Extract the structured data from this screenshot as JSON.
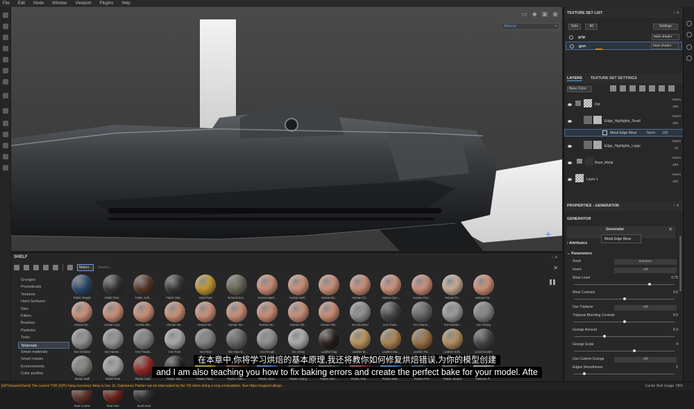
{
  "menu": [
    "File",
    "Edit",
    "Mode",
    "Window",
    "Viewport",
    "Plugins",
    "Help"
  ],
  "viewport": {
    "display_select": "Material"
  },
  "shelf": {
    "title": "SHELF",
    "filter_label": "Materi...",
    "search_placeholder": "Search...",
    "categories": [
      "Grunges",
      "Procedurals",
      "Textures",
      "Hard Surfaces",
      "Skin",
      "Filters",
      "Brushes",
      "Particles",
      "Tools",
      "Materials",
      "Smart materials",
      "Smart masks",
      "Environments",
      "Color profiles"
    ],
    "selected_category": "Materials",
    "materials": [
      {
        "name": "Fabric Rough",
        "color": "#2f4f73"
      },
      {
        "name": "Fabric Rou...",
        "color": "#3a3a3a"
      },
      {
        "name": "Fabric Soft ...",
        "color": "#5b3a2e"
      },
      {
        "name": "Fabric Suit ...",
        "color": "#3b3b3b"
      },
      {
        "name": "Gold Pure",
        "color": "#c9a133"
      },
      {
        "name": "Ground Gra...",
        "color": "#6e6a5c"
      },
      {
        "name": "Human Back...",
        "color": "#d7967e"
      },
      {
        "name": "Human Bell...",
        "color": "#d99a82"
      },
      {
        "name": "Human Bu...",
        "color": "#d99a80"
      },
      {
        "name": "Human Ch...",
        "color": "#d9987f"
      },
      {
        "name": "Human Eye...",
        "color": "#dc9c84"
      },
      {
        "name": "Human Fac...",
        "color": "#d99880"
      },
      {
        "name": "Human Fe...",
        "color": "#d6b8a0"
      },
      {
        "name": "Human For...",
        "color": "#db9880"
      },
      {
        "name": "Human He...",
        "color": "#da9a82"
      },
      {
        "name": "Human Leg...",
        "color": "#d8987f"
      },
      {
        "name": "Human Mo...",
        "color": "#d8987f"
      },
      {
        "name": "Human Ne...",
        "color": "#d9987f"
      },
      {
        "name": "Human Ne...",
        "color": "#da9980"
      },
      {
        "name": "Human No...",
        "color": "#d9987f"
      },
      {
        "name": "Human No...",
        "color": "#d8967e"
      },
      {
        "name": "Human Shi...",
        "color": "#d9997f"
      },
      {
        "name": "Human Wri...",
        "color": "#d7977e"
      },
      {
        "name": "Iron Brushed",
        "color": "#9a9a9a"
      },
      {
        "name": "Iron Chain...",
        "color": "#4a4a4a"
      },
      {
        "name": "Iron Diamo...",
        "color": "#6b6b6b"
      },
      {
        "name": "Iron Galvan...",
        "color": "#a5a5a5"
      },
      {
        "name": "Iron Grainy",
        "color": "#8e8e8e"
      },
      {
        "name": "Iron Grinded",
        "color": "#9c9c9c"
      },
      {
        "name": "Iron Hamm...",
        "color": "#a0a0a0"
      },
      {
        "name": "Iron Powde...",
        "color": "#8a8a8a"
      },
      {
        "name": "Iron Pure",
        "color": "#b4b4b4"
      },
      {
        "name": "Iron Raw",
        "color": "#8c8c8c"
      },
      {
        "name": "Iron Raw D...",
        "color": "#6a6a6a"
      },
      {
        "name": "Iron Rough",
        "color": "#9a9a9a"
      },
      {
        "name": "Iron Shiny",
        "color": "#b8b8b8"
      },
      {
        "name": "Leather bag",
        "color": "#2c2420"
      },
      {
        "name": "Leather Bi...",
        "color": "#caa063"
      },
      {
        "name": "Leather Ma...",
        "color": "#b98c56"
      },
      {
        "name": "Leather Ro...",
        "color": "#a57848"
      },
      {
        "name": "Leather Soft...",
        "color": "#bf9a66"
      },
      {
        "name": "Lizard Scales",
        "color": "#4a4a4a"
      },
      {
        "name": "Mortar Wall",
        "color": "#8a8a86"
      },
      {
        "name": "Nickel Pure",
        "color": "#b0b0b0"
      },
      {
        "name": "Plastic Cabl...",
        "color": "#9e2a25"
      },
      {
        "name": "Plastic Dia...",
        "color": "#2a2a2a"
      },
      {
        "name": "Plastic Fabri...",
        "color": "#d4b21e"
      },
      {
        "name": "Plastic Fabri...",
        "color": "#7a3a22"
      },
      {
        "name": "Plastic Glos...",
        "color": "#2f7fd6"
      },
      {
        "name": "Plastic Grainy",
        "color": "#2c2c2c"
      },
      {
        "name": "Plastic Grid ...",
        "color": "#55606b"
      },
      {
        "name": "Plastic Grid ...",
        "color": "#9b2727"
      },
      {
        "name": "Plastic Matt...",
        "color": "#2f86e0"
      },
      {
        "name": "Plastic PVC",
        "color": "#1f3a55"
      },
      {
        "name": "Plastic Stripes",
        "color": "#5a5a5a"
      },
      {
        "name": "Platinum P...",
        "color": "#b6b6b6"
      },
      {
        "name": "Rust Coarse",
        "color": "#6b3a2e"
      },
      {
        "name": "Rust Fine",
        "color": "#7a2b22"
      },
      {
        "name": "Scarf wool",
        "color": "#3a3a3a"
      }
    ]
  },
  "texture_set_list": {
    "title": "TEXTURE SET LIST",
    "solo": "Solo",
    "all": "All",
    "settings": "Settings",
    "sets": [
      {
        "name": "grip",
        "shader": "Main shader"
      },
      {
        "name": "gun",
        "shader": "Main shader"
      }
    ]
  },
  "layers_panel": {
    "tab_layers": "LAYERS",
    "tab_settings": "TEXTURE SET SETTINGS",
    "channel": "Base Color",
    "layers": [
      {
        "name": "Dirt",
        "blend": "Norm",
        "opacity": "100"
      },
      {
        "name": "Edge_Highlights_Small",
        "blend": "Norm",
        "opacity": "100"
      },
      {
        "name": "Metal Edge Wear",
        "blend": "Norm",
        "opacity": "100"
      },
      {
        "name": "Edge_Highlights_Large",
        "blend": "Norm",
        "opacity": "10"
      },
      {
        "name": "Base_Metal",
        "blend": "Norm",
        "opacity": "100"
      },
      {
        "name": "Layer 1",
        "blend": "Norm",
        "opacity": "100"
      }
    ]
  },
  "properties": {
    "title": "PROPERTIES - GENERATOR",
    "section": "GENERATOR",
    "generator_label": "Generator",
    "tooltip": "Metal Edge Wear",
    "attributes": "Attributes",
    "parameters": "Parameters",
    "params": [
      {
        "label": "Seed",
        "field": "Random"
      },
      {
        "label": "Invert",
        "field": "Off"
      },
      {
        "label": "Wear Level",
        "value": "0.75",
        "slider": 0.75
      },
      {
        "label": "Wear Contrast",
        "value": "0.5",
        "slider": 0.5
      },
      {
        "label": "Use Triplanar",
        "field": "Off"
      },
      {
        "label": "Triplanar Blending Contrast",
        "value": "0.5",
        "slider": 0.5
      },
      {
        "label": "Grunge Amount",
        "value": "0.3",
        "slider": 0.3
      },
      {
        "label": "Grunge Scale",
        "value": "4",
        "slider": 0.6
      },
      {
        "label": "Use Custom Grunge",
        "field": "Off"
      },
      {
        "label": "Edges Smoothness",
        "value": "1",
        "slider": 0.1
      }
    ]
  },
  "status": {
    "warning": "[GPUIssuesCheck] The current TDR (GPU hang recovery) delay is low: 2s. Substance Painter can be interrupted by the OS when doing a long computation. See https://support.allego...",
    "cache": "Cache Disk Usage:   58%"
  },
  "subtitles": {
    "cn": "在本章中,你将学习烘焙的基本原理,我还将教你如何修复烘焙错误,为你的模型创建",
    "en": "and I am also teaching you how to fix baking errors and create the perfect bake for your model. Afte"
  }
}
